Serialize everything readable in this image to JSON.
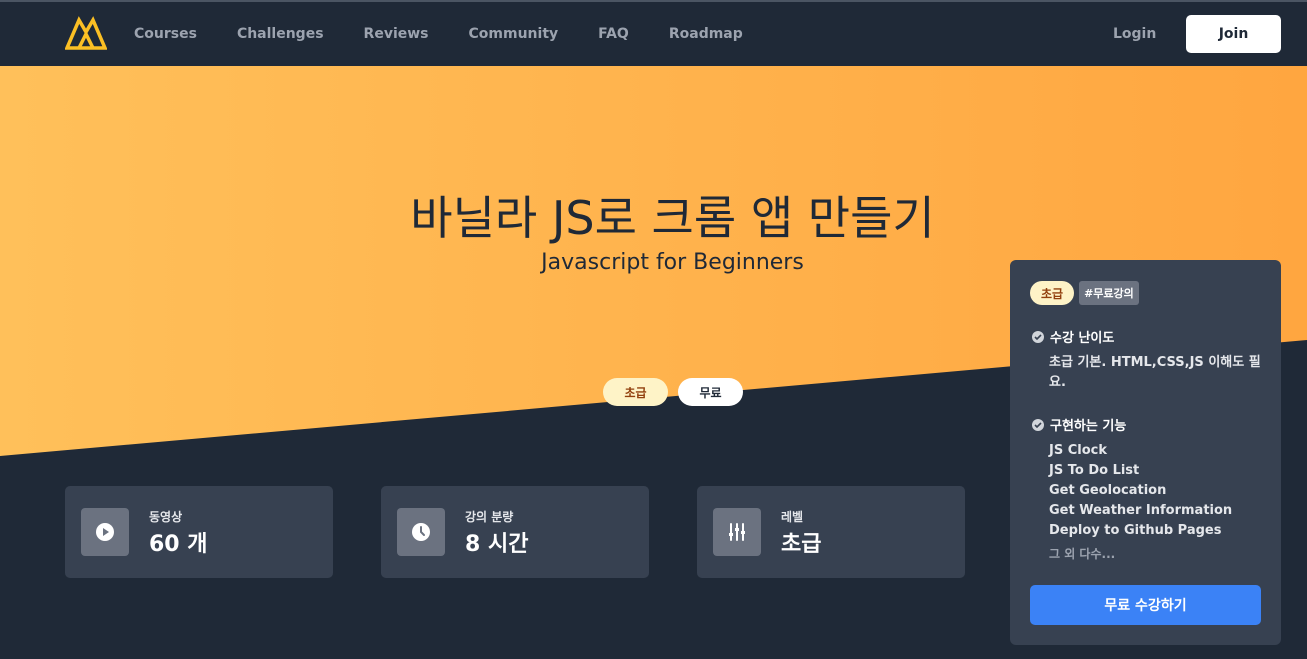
{
  "nav": {
    "logo_name": "nomad-logo",
    "links": [
      "Courses",
      "Challenges",
      "Reviews",
      "Community",
      "FAQ",
      "Roadmap"
    ],
    "login": "Login",
    "join": "Join"
  },
  "hero": {
    "title": "바닐라 JS로 크롬 앱 만들기",
    "subtitle": "Javascript for Beginners",
    "badges": {
      "level": "초급",
      "price": "무료"
    },
    "gradient": [
      "#ffc05a",
      "#ffa640"
    ]
  },
  "stats": [
    {
      "icon": "play-icon",
      "label": "동영상",
      "value": "60 개"
    },
    {
      "icon": "clock-icon",
      "label": "강의 분량",
      "value": "8 시간"
    },
    {
      "icon": "sliders-icon",
      "label": "레벨",
      "value": "초급"
    }
  ],
  "side_card": {
    "tag_level": "초급",
    "tag_hash": "#무료강의",
    "difficulty_title": "수강 난이도",
    "difficulty_text": "초급 기본. HTML,CSS,JS 이해도 필요.",
    "features_title": "구현하는 기능",
    "features": [
      "JS Clock",
      "JS To Do List",
      "Get Geolocation",
      "Get Weather Information",
      "Deploy to Github Pages"
    ],
    "more": "그 외 다수...",
    "cta": "무료 수강하기"
  },
  "colors": {
    "nav_bg": "#1f2937",
    "card_bg": "#374151",
    "cta": "#3b82f6",
    "accent": "#fbbf24"
  }
}
